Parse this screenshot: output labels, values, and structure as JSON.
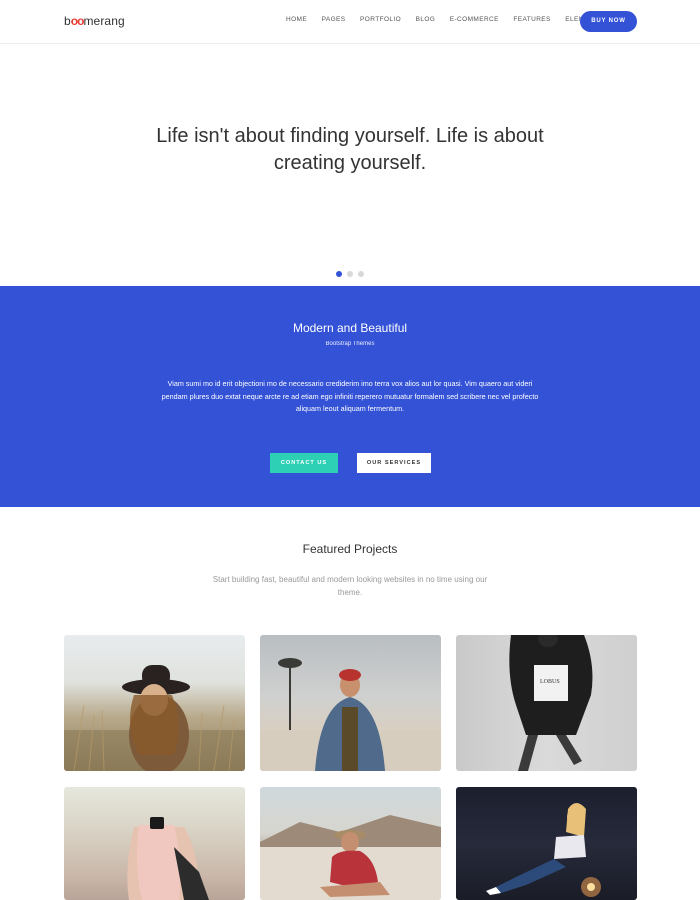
{
  "header": {
    "logo": "boomerang",
    "nav": [
      "HOME",
      "PAGES",
      "PORTFOLIO",
      "BLOG",
      "E-COMMERCE",
      "FEATURES",
      "ELEMENTS"
    ],
    "cta": "BUY NOW"
  },
  "hero": {
    "quote": "Life isn't about finding yourself. Life is about creating yourself.",
    "slides": 3,
    "active_slide": 1
  },
  "band": {
    "title": "Modern and Beautiful",
    "subtitle": "Bootstrap Themes",
    "text": "Viam sumi mo id erit objectioni mo de necessario crediderim imo terra vox alios aut lor quasi. Vim quaero aut videri pendam plures duo extat neque arcte re ad etiam ego infiniti reperero mutuatur formalem sed scribere nec vel profecto aliquam leout aliquam fermentum.",
    "contact_label": "CONTACT US",
    "services_label": "OUR SERVICES"
  },
  "featured": {
    "title": "Featured Projects",
    "text": "Start building fast, beautiful and modern looking websites in no time using our theme."
  },
  "colors": {
    "primary": "#3352d6",
    "accent": "#2ed0b5",
    "logo_accent": "#e63c32"
  }
}
